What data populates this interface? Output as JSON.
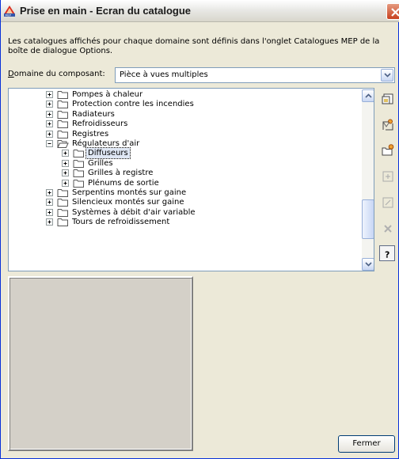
{
  "window": {
    "title": "Prise en main - Ecran du catalogue",
    "app_icon": "autocad-mep-icon",
    "close_icon": "close-icon"
  },
  "description": "Les catalogues affichés pour chaque domaine sont définis dans l'onglet Catalogues MEP de la boîte de dialogue Options.",
  "domain": {
    "label_accel": "D",
    "label_rest": "omaine du composant:",
    "selected": "Pièce à vues multiples"
  },
  "tree": {
    "items": [
      {
        "label": "Pompes à chaleur",
        "state": "collapsed"
      },
      {
        "label": "Protection contre les incendies",
        "state": "collapsed"
      },
      {
        "label": "Radiateurs",
        "state": "collapsed"
      },
      {
        "label": "Refroidisseurs",
        "state": "collapsed"
      },
      {
        "label": "Registres",
        "state": "collapsed"
      },
      {
        "label": "Régulateurs d'air",
        "state": "expanded"
      },
      {
        "label": "Diffuseurs",
        "state": "collapsed",
        "selected": true
      },
      {
        "label": "Grilles",
        "state": "collapsed"
      },
      {
        "label": "Grilles à registre",
        "state": "collapsed"
      },
      {
        "label": "Plénums de sortie",
        "state": "collapsed"
      },
      {
        "label": "Serpentins montés sur gaine",
        "state": "collapsed"
      },
      {
        "label": "Silencieux montés sur gaine",
        "state": "collapsed"
      },
      {
        "label": "Systèmes à débit d'air variable",
        "state": "collapsed"
      },
      {
        "label": "Tours de refroidissement",
        "state": "collapsed"
      }
    ]
  },
  "side_toolbar": [
    {
      "icon": "open-catalog-icon",
      "enabled": true
    },
    {
      "icon": "content-browser-icon",
      "enabled": true
    },
    {
      "icon": "open-folder-icon",
      "enabled": true
    },
    {
      "icon": "add-item-icon",
      "enabled": false
    },
    {
      "icon": "edit-item-icon",
      "enabled": false
    },
    {
      "icon": "delete-icon",
      "enabled": false
    },
    {
      "icon": "help-icon",
      "enabled": true
    }
  ],
  "buttons": {
    "close_label": "Fermer"
  }
}
